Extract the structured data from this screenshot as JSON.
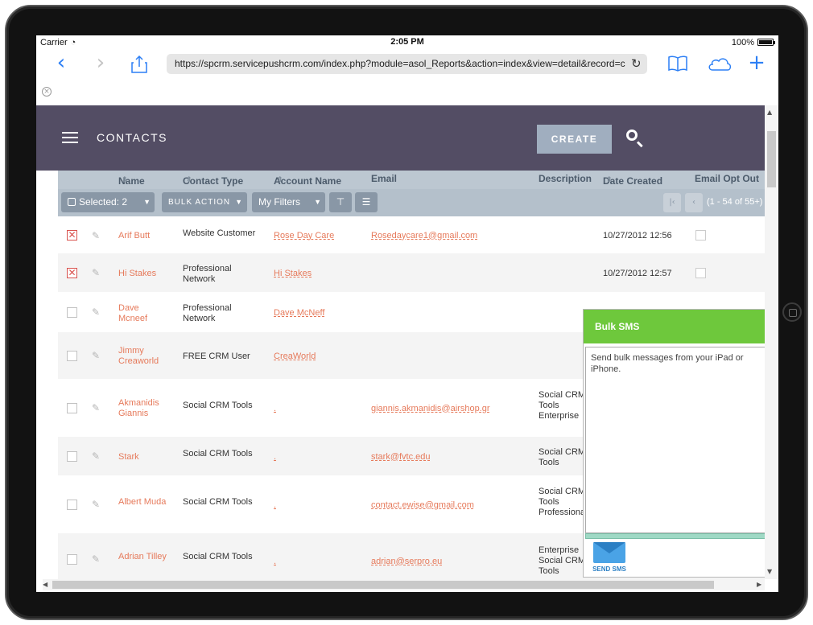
{
  "status_bar": {
    "carrier": "Carrier",
    "time": "2:05 PM",
    "battery": "100%"
  },
  "browser": {
    "url": "https://spcrm.servicepushcrm.com/index.php?module=asol_Reports&action=index&view=detail&record=c",
    "icons": [
      "back-icon",
      "forward-icon",
      "share-icon",
      "reload-icon",
      "bookmarks-icon",
      "cloud-icon",
      "new-tab-icon",
      "close-tab-icon"
    ]
  },
  "header": {
    "module_title": "CONTACTS",
    "create_label": "CREATE"
  },
  "columns": [
    "Name",
    "Contact Type",
    "Account Name",
    "Email",
    "Description",
    "Date Created",
    "Email Opt Out"
  ],
  "toolbar": {
    "selected_label": "Selected: 2",
    "bulk_action_label": "BULK ACTION",
    "filters_label": "My Filters",
    "pagination": "(1 - 54 of 55+)"
  },
  "rows": [
    {
      "checked": true,
      "name": "Arif Butt",
      "contact_type": "Website Customer",
      "account": "Rose Day Care",
      "email": "Rosedaycare1@gmail.com",
      "description": "",
      "date_created": "10/27/2012 12:56"
    },
    {
      "checked": true,
      "name": "Hi Stakes",
      "contact_type": "Professional Network",
      "account": "Hi Stakes",
      "email": "",
      "description": "",
      "date_created": "10/27/2012 12:57"
    },
    {
      "checked": false,
      "name": "Dave Mcneef",
      "contact_type": "Professional Network",
      "account": "Dave McNeff",
      "email": "",
      "description": "",
      "date_created": ""
    },
    {
      "checked": false,
      "name": "Jimmy Creaworld",
      "contact_type": "FREE CRM User",
      "account": "CreaWorld",
      "email": "",
      "description": "",
      "date_created": ""
    },
    {
      "checked": false,
      "name": "Akmanidis Giannis",
      "contact_type": "Social CRM Tools",
      "account": ".",
      "email": "giannis.akmanidis@airshop.gr",
      "description": "Social CRM Tools Enterprise",
      "date_created": ""
    },
    {
      "checked": false,
      "name": "Stark",
      "contact_type": "Social CRM Tools",
      "account": ".",
      "email": "stark@fvtc.edu",
      "description": "Social CRM Tools",
      "date_created": ""
    },
    {
      "checked": false,
      "name": "Albert Muda",
      "contact_type": "Social CRM Tools",
      "account": ".",
      "email": "contact.ewise@gmail.com",
      "description": "Social CRM Tools Professional",
      "date_created": ""
    },
    {
      "checked": false,
      "name": "Adrian Tilley",
      "contact_type": "Social CRM Tools",
      "account": ".",
      "email": "adrian@serpro.eu",
      "description": "Enterprise Social CRM Tools",
      "date_created": ""
    }
  ],
  "bulk_sms": {
    "title": "Bulk SMS",
    "message": "Send bulk messages from your iPad or iPhone.",
    "send_label": "SEND SMS"
  },
  "colors": {
    "header_bg": "#534d64",
    "sms_header": "#6ec83c",
    "link": "#e67a5b",
    "create_btn": "#a0aebf"
  }
}
